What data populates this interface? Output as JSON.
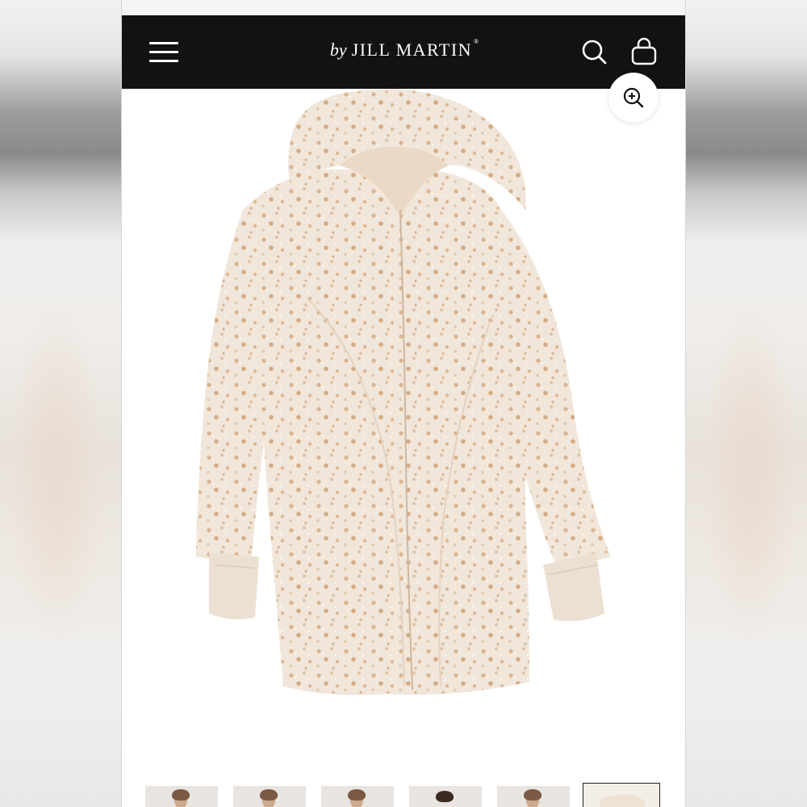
{
  "brand": {
    "prefix": "by",
    "name": "JILL MARTIN",
    "mark": "®"
  },
  "header": {
    "menu_icon": "hamburger-menu-icon",
    "search_icon": "search-icon",
    "bag_icon": "shopping-bag-icon"
  },
  "product_image": {
    "subject": "coat",
    "zoom_icon": "zoom-in-icon"
  },
  "thumbnails": [
    {
      "index": 1,
      "active": false
    },
    {
      "index": 2,
      "active": false
    },
    {
      "index": 3,
      "active": false
    },
    {
      "index": 4,
      "active": false
    },
    {
      "index": 5,
      "active": false
    },
    {
      "index": 6,
      "active": true
    }
  ],
  "colors": {
    "header_bg": "#121212",
    "coat_base": "#f1e6da",
    "coat_spot": "#d9b48f"
  }
}
